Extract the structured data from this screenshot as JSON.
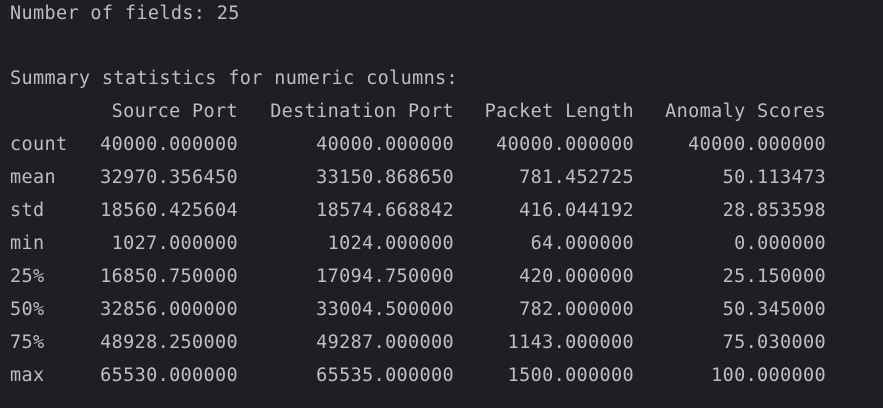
{
  "console": {
    "fields_line": "Number of fields: 25",
    "summary_title": "Summary statistics for numeric columns:",
    "columns": [
      "Source Port",
      "Destination Port",
      "Packet Length",
      "Anomaly Scores"
    ],
    "rows": [
      {
        "label": "count",
        "values": [
          "40000.000000",
          "40000.000000",
          "40000.000000",
          "40000.000000"
        ]
      },
      {
        "label": "mean",
        "values": [
          "32970.356450",
          "33150.868650",
          "781.452725",
          "50.113473"
        ]
      },
      {
        "label": "std",
        "values": [
          "18560.425604",
          "18574.668842",
          "416.044192",
          "28.853598"
        ]
      },
      {
        "label": "min",
        "values": [
          "1027.000000",
          "1024.000000",
          "64.000000",
          "0.000000"
        ]
      },
      {
        "label": "25%",
        "values": [
          "16850.750000",
          "17094.750000",
          "420.000000",
          "25.150000"
        ]
      },
      {
        "label": "50%",
        "values": [
          "32856.000000",
          "33004.500000",
          "782.000000",
          "50.345000"
        ]
      },
      {
        "label": "75%",
        "values": [
          "48928.250000",
          "49287.000000",
          "1143.000000",
          "75.030000"
        ]
      },
      {
        "label": "max",
        "values": [
          "65530.000000",
          "65535.000000",
          "1500.000000",
          "100.000000"
        ]
      }
    ]
  }
}
